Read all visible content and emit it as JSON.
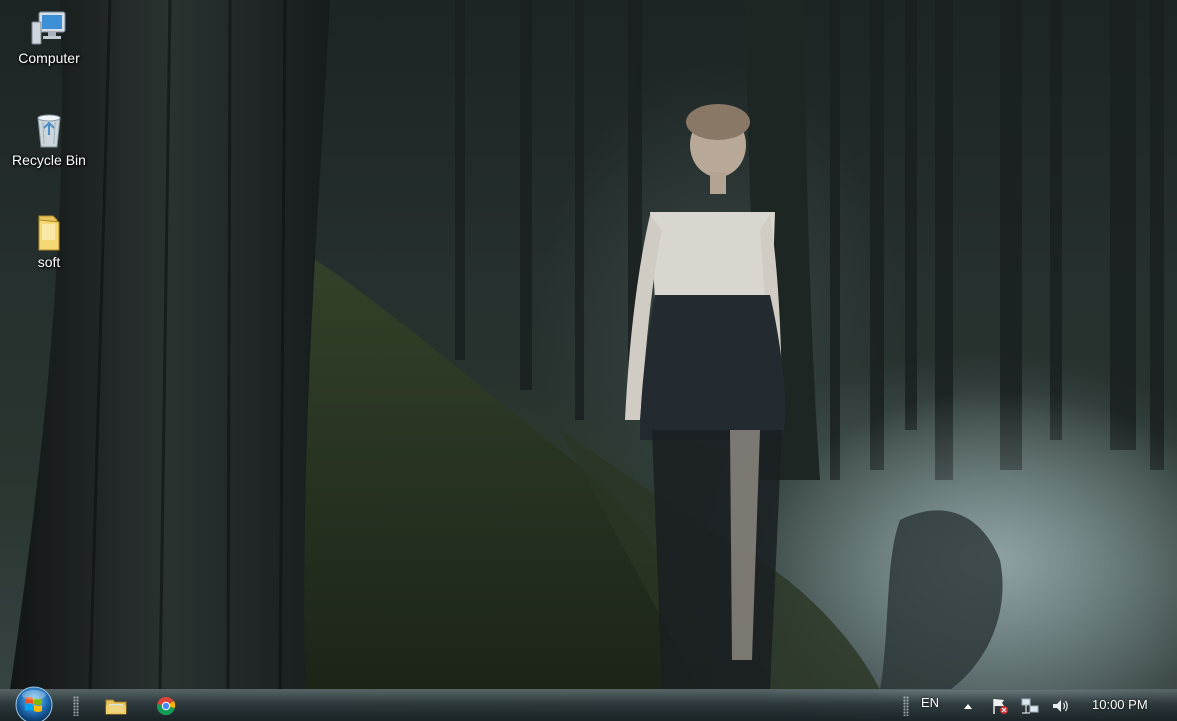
{
  "desktop": {
    "icons": [
      {
        "label": "Computer",
        "icon": "computer-icon"
      },
      {
        "label": "Recycle Bin",
        "icon": "recycle-bin-icon"
      },
      {
        "label": "soft",
        "icon": "folder-icon"
      }
    ]
  },
  "taskbar": {
    "pinned": [
      {
        "icon": "file-explorer-icon"
      },
      {
        "icon": "chrome-icon"
      }
    ],
    "tray": {
      "language": "EN",
      "clock": "10:00 PM",
      "icons": [
        "show-hidden-icons",
        "action-center-flag-icon",
        "network-icon",
        "volume-icon"
      ]
    }
  },
  "colors": {
    "taskbar": "#1e2a2e",
    "label_text": "#ffffff"
  }
}
